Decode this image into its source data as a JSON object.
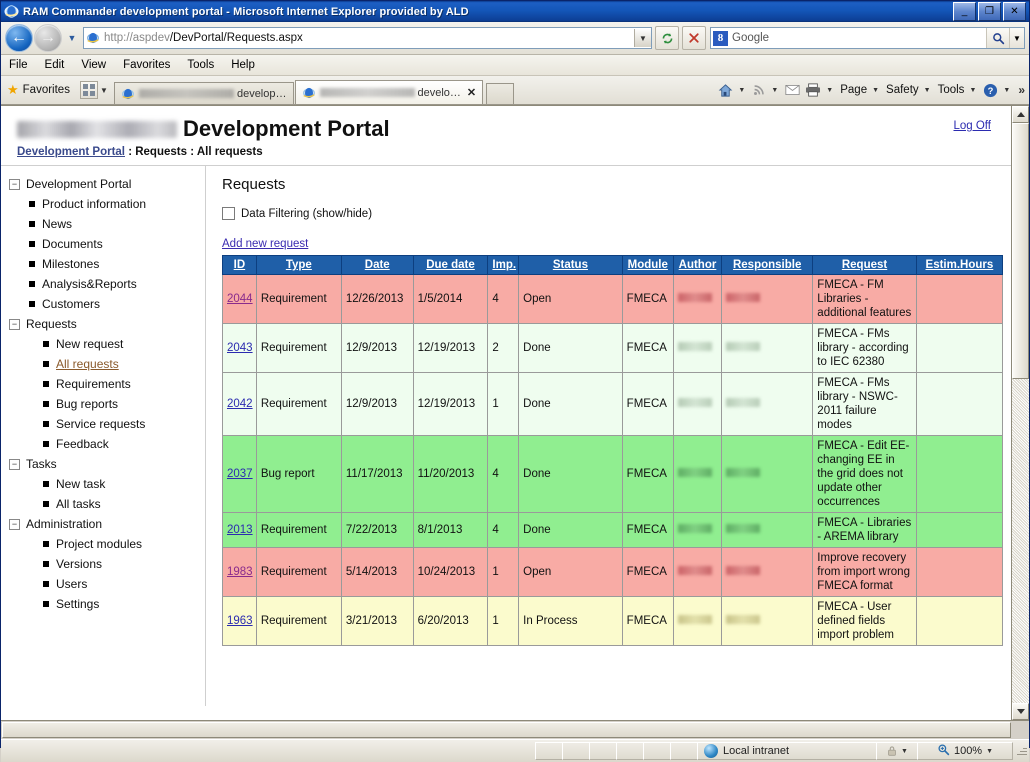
{
  "window": {
    "title": "RAM Commander development portal - Microsoft Internet Explorer provided by ALD",
    "minimize": "_",
    "maximize": "❐",
    "close": "✕"
  },
  "address_bar": {
    "url_host": "http://aspdev",
    "url_path": "/DevPortal/Requests.aspx",
    "refresh_icon": "refresh-icon",
    "stop_icon": "stop-icon",
    "search_engine": "Google",
    "search_logo_letter": "8",
    "go_icon": "search-icon"
  },
  "menu": {
    "items": [
      "File",
      "Edit",
      "View",
      "Favorites",
      "Tools",
      "Help"
    ]
  },
  "favorites_bar": {
    "favorites_label": "Favorites",
    "tabs": [
      {
        "title_tail": "develop…",
        "active": false,
        "redacted": true
      },
      {
        "title_tail": "develo…",
        "active": true,
        "redacted": true,
        "close": "✕"
      }
    ]
  },
  "command_bar": {
    "items": [
      "Page",
      "Safety",
      "Tools"
    ],
    "home_icon": "home-icon",
    "feeds_icon": "rss-icon",
    "mail_icon": "mail-icon",
    "print_icon": "printer-icon",
    "help_icon": "help-icon",
    "overflow": "»"
  },
  "page": {
    "logo_redacted": true,
    "title": "Development Portal",
    "log_off": "Log Off",
    "breadcrumb": {
      "root": "Development Portal",
      "sep": " : ",
      "parts": [
        "Requests",
        "All requests"
      ]
    }
  },
  "sidebar": {
    "nodes": [
      {
        "label": "Development Portal",
        "type": "root",
        "expander": "−"
      },
      {
        "label": "Product information",
        "type": "item"
      },
      {
        "label": "News",
        "type": "item"
      },
      {
        "label": "Documents",
        "type": "item"
      },
      {
        "label": "Milestones",
        "type": "item"
      },
      {
        "label": "Analysis&Reports",
        "type": "item"
      },
      {
        "label": "Customers",
        "type": "item"
      },
      {
        "label": "Requests",
        "type": "root",
        "expander": "−"
      },
      {
        "label": "New request",
        "type": "sub"
      },
      {
        "label": "All requests",
        "type": "sub",
        "current": true
      },
      {
        "label": "Requirements",
        "type": "sub"
      },
      {
        "label": "Bug reports",
        "type": "sub"
      },
      {
        "label": "Service requests",
        "type": "sub"
      },
      {
        "label": "Feedback",
        "type": "sub"
      },
      {
        "label": "Tasks",
        "type": "root",
        "expander": "−"
      },
      {
        "label": "New task",
        "type": "sub"
      },
      {
        "label": "All tasks",
        "type": "sub"
      },
      {
        "label": "Administration",
        "type": "root",
        "expander": "−"
      },
      {
        "label": "Project modules",
        "type": "sub"
      },
      {
        "label": "Versions",
        "type": "sub"
      },
      {
        "label": "Users",
        "type": "sub"
      },
      {
        "label": "Settings",
        "type": "sub"
      }
    ]
  },
  "content": {
    "heading": "Requests",
    "filter_label": "Data Filtering (show/hide)",
    "filter_checked": false,
    "add_new_link": "Add new request",
    "table": {
      "columns": [
        "ID",
        "Type",
        "Date",
        "Due date",
        "Imp.",
        "Status",
        "Module",
        "Author",
        "Responsible",
        "Request",
        "Estim.Hours"
      ],
      "rows": [
        {
          "id": "2044",
          "type": "Requirement",
          "date": "12/26/2013",
          "due_date": "1/5/2014",
          "imp": "4",
          "status": "Open",
          "module": "FMECA",
          "author": "",
          "author_redacted": true,
          "responsible": "",
          "responsible_redacted": true,
          "request": "FMECA - FM Libraries - additional features",
          "estim_hours": "",
          "row_style": "open"
        },
        {
          "id": "2043",
          "type": "Requirement",
          "date": "12/9/2013",
          "due_date": "12/19/2013",
          "imp": "2",
          "status": "Done",
          "module": "FMECA",
          "author": "",
          "author_redacted": true,
          "responsible": "",
          "responsible_redacted": true,
          "request": "FMECA - FMs library - according to IEC 62380",
          "estim_hours": "",
          "row_style": "done-lite"
        },
        {
          "id": "2042",
          "type": "Requirement",
          "date": "12/9/2013",
          "due_date": "12/19/2013",
          "imp": "1",
          "status": "Done",
          "module": "FMECA",
          "author": "",
          "author_redacted": true,
          "responsible": "",
          "responsible_redacted": true,
          "request": "FMECA - FMs library - NSWC-2011 failure modes",
          "estim_hours": "",
          "row_style": "done-lite"
        },
        {
          "id": "2037",
          "type": "Bug report",
          "date": "11/17/2013",
          "due_date": "11/20/2013",
          "imp": "4",
          "status": "Done",
          "module": "FMECA",
          "author": "",
          "author_redacted": true,
          "responsible": "",
          "responsible_redacted": true,
          "request": "FMECA - Edit EE- changing EE in the grid does not update other occurrences",
          "estim_hours": "",
          "row_style": "done"
        },
        {
          "id": "2013",
          "type": "Requirement",
          "date": "7/22/2013",
          "due_date": "8/1/2013",
          "imp": "4",
          "status": "Done",
          "module": "FMECA",
          "author": "",
          "author_redacted": true,
          "responsible": "",
          "responsible_redacted": true,
          "request": "FMECA - Libraries - AREMA library",
          "estim_hours": "",
          "row_style": "done"
        },
        {
          "id": "1983",
          "type": "Requirement",
          "date": "5/14/2013",
          "due_date": "10/24/2013",
          "imp": "1",
          "status": "Open",
          "module": "FMECA",
          "author": "",
          "author_redacted": true,
          "responsible": "",
          "responsible_redacted": true,
          "request": "Improve recovery from import wrong FMECA format",
          "estim_hours": "",
          "row_style": "open"
        },
        {
          "id": "1963",
          "type": "Requirement",
          "date": "3/21/2013",
          "due_date": "6/20/2013",
          "imp": "1",
          "status": "In Process",
          "module": "FMECA",
          "author": "",
          "author_redacted": true,
          "responsible": "",
          "responsible_redacted": true,
          "request": "FMECA - User defined fields import problem",
          "estim_hours": "",
          "row_style": "in-process"
        }
      ]
    }
  },
  "status_bar": {
    "zone": "Local intranet",
    "zoom": "100%",
    "security_icon": "lock-icon",
    "zoom_icon": "magnifier-icon"
  },
  "colors": {
    "header_blue": "#1f5fa8",
    "row_open": "#f8aba5",
    "row_done": "#90ee90",
    "row_done_lite": "#effdef",
    "row_in_process": "#fbfbcd",
    "link": "#2b2bb0",
    "title_bar": "#1456b8"
  }
}
